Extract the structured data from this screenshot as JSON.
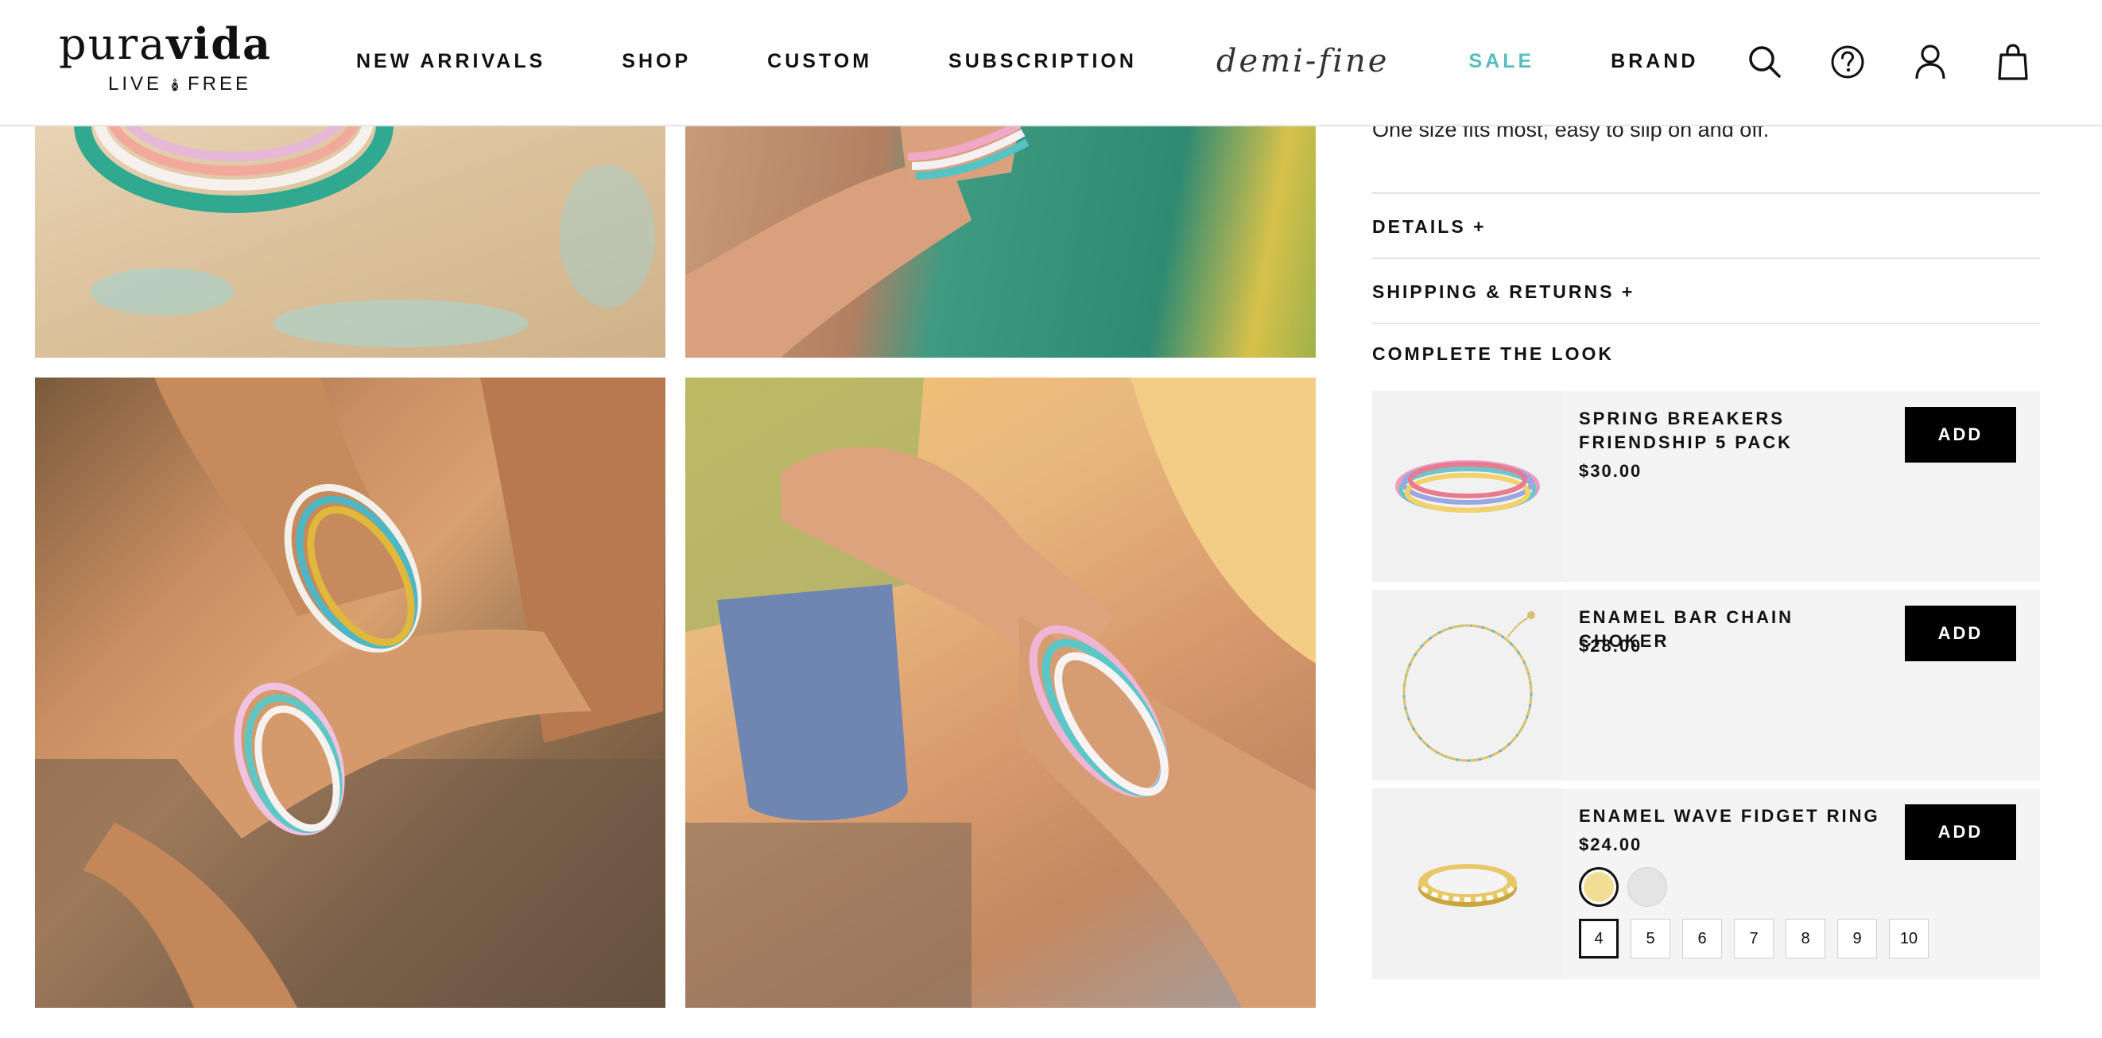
{
  "brand": {
    "name_light": "pura",
    "name_bold": "vida",
    "tagline_left": "LIVE",
    "tagline_right": "FREE"
  },
  "nav": {
    "new_arrivals": "NEW ARRIVALS",
    "shop": "SHOP",
    "custom": "CUSTOM",
    "subscription": "SUBSCRIPTION",
    "demi_fine": "demi-fine",
    "sale": "SALE",
    "brand": "BRAND"
  },
  "header_icons": [
    "search-icon",
    "help-icon",
    "account-icon",
    "bag-icon"
  ],
  "colors": {
    "sale_accent": "#5bbcbf",
    "add_button": "#000000",
    "card_bg": "#f4f4f4"
  },
  "gallery": [
    "bracelets-in-sand-photo",
    "wrist-on-surfboard-photo",
    "crossed-arms-bracelets-photo",
    "holding-smoothie-photo"
  ],
  "product": {
    "description": "One size fits most, easy to slip on and off.",
    "details_label": "DETAILS +",
    "shipping_label": "SHIPPING & RETURNS +"
  },
  "complete_the_look": {
    "title": "COMPLETE THE LOOK",
    "items": [
      {
        "name": "SPRING BREAKERS FRIENDSHIP 5 PACK",
        "price": "$30.00",
        "button": "ADD"
      },
      {
        "name": "ENAMEL BAR CHAIN CHOKER",
        "price": "$28.00",
        "button": "ADD"
      },
      {
        "name": "ENAMEL WAVE FIDGET RING",
        "price": "$24.00",
        "button": "ADD",
        "swatches": [
          {
            "name": "gold",
            "color": "#f1dd94",
            "selected": true
          },
          {
            "name": "silver",
            "color": "#e4e4e4",
            "selected": false
          }
        ],
        "sizes": [
          "4",
          "5",
          "6",
          "7",
          "8",
          "9",
          "10"
        ],
        "selected_size": "4"
      }
    ]
  }
}
